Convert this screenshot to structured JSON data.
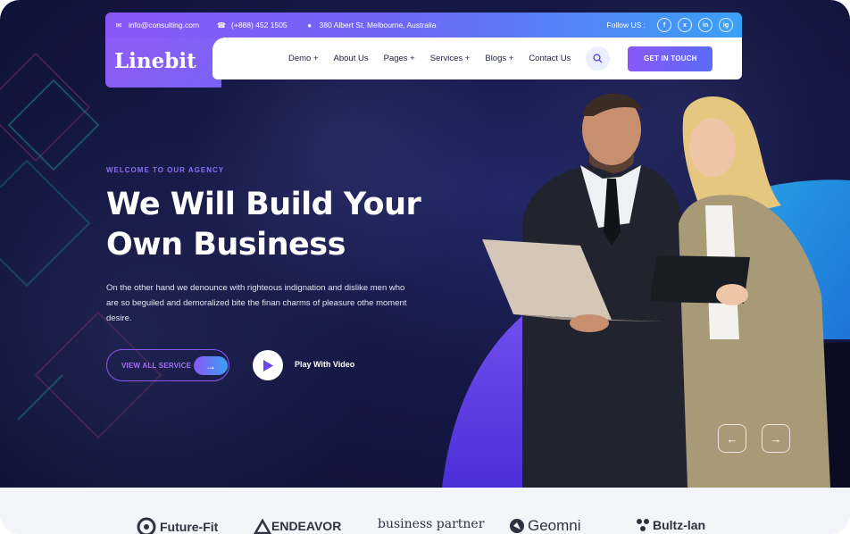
{
  "topbar": {
    "email": "info@consulting.com",
    "phone": "(+888) 452 1505",
    "address": "380 Albert St, Melbourne, Australia",
    "follow_label": "Follow US :",
    "socials": [
      "f",
      "x",
      "in",
      "ig"
    ]
  },
  "brand": {
    "logo": "Linebit"
  },
  "nav": {
    "items": [
      "Demo +",
      "About Us",
      "Pages +",
      "Services +",
      "Blogs +",
      "Contact Us"
    ],
    "cta": "GET IN TOUCH"
  },
  "hero": {
    "eyebrow": "WELCOME TO OUR AGENCY",
    "headline_line1": "We Will Build Your",
    "headline_line2": "Own Business",
    "description": "On the other hand we denounce with righteous indignation and dislike men who are so beguiled and demoralized bite the finan charms of pleasure othe moment desire.",
    "service_button": "VIEW ALL SERVICE",
    "play_label": "Play With Video"
  },
  "partners": [
    "Future-Fit",
    "ENDEAVOR",
    "business partner",
    "Geomni",
    "Bultz-lan"
  ],
  "colors": {
    "accent_purple": "#8a57f7",
    "accent_blue": "#3aa0f5",
    "hero_bg": "#151844"
  }
}
